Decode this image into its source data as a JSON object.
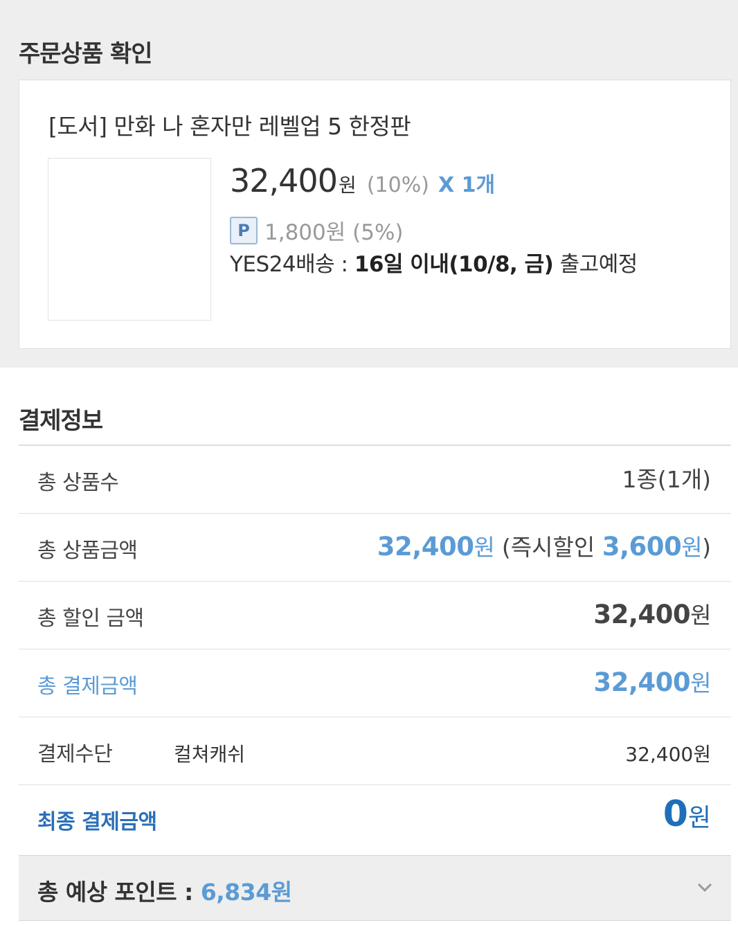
{
  "order": {
    "title": "주문상품 확인",
    "product": {
      "name": "[도서] 만화 나 혼자만 레벨업 5 한정판",
      "price": "32,400",
      "price_unit": "원",
      "discount": "(10%)",
      "quantity": "X 1개",
      "point_badge": "P",
      "point": "1,800원 (5%)",
      "shipping_label": "YES24배송 : ",
      "shipping_bold": "16일 이내(10/8, 금)",
      "shipping_suffix": " 출고예정"
    }
  },
  "payment": {
    "title": "결제정보",
    "total_items": {
      "label": "총 상품수",
      "value": "1종(1개)"
    },
    "total_amount": {
      "label": "총 상품금액",
      "value": "32,400",
      "unit": "원",
      "paren_open": " (즉시할인 ",
      "instant_discount": "3,600",
      "instant_unit": "원",
      "paren_close": ")"
    },
    "total_discount": {
      "label": "총 할인 금액",
      "value": "32,400",
      "unit": "원"
    },
    "total_payment": {
      "label": "총 결제금액",
      "value": "32,400",
      "unit": "원"
    },
    "method": {
      "label": "결제수단",
      "name": "컬쳐캐쉬",
      "amount": "32,400원"
    },
    "final": {
      "label": "최종 결제금액",
      "value": "0",
      "unit": "원"
    },
    "expected_points": {
      "label": "총 예상 포인트 : ",
      "value": "6,834원"
    }
  },
  "colors": {
    "accent": "#5b9bd5",
    "final_accent": "#1f6fb8",
    "section_bg": "#eeeeee"
  }
}
